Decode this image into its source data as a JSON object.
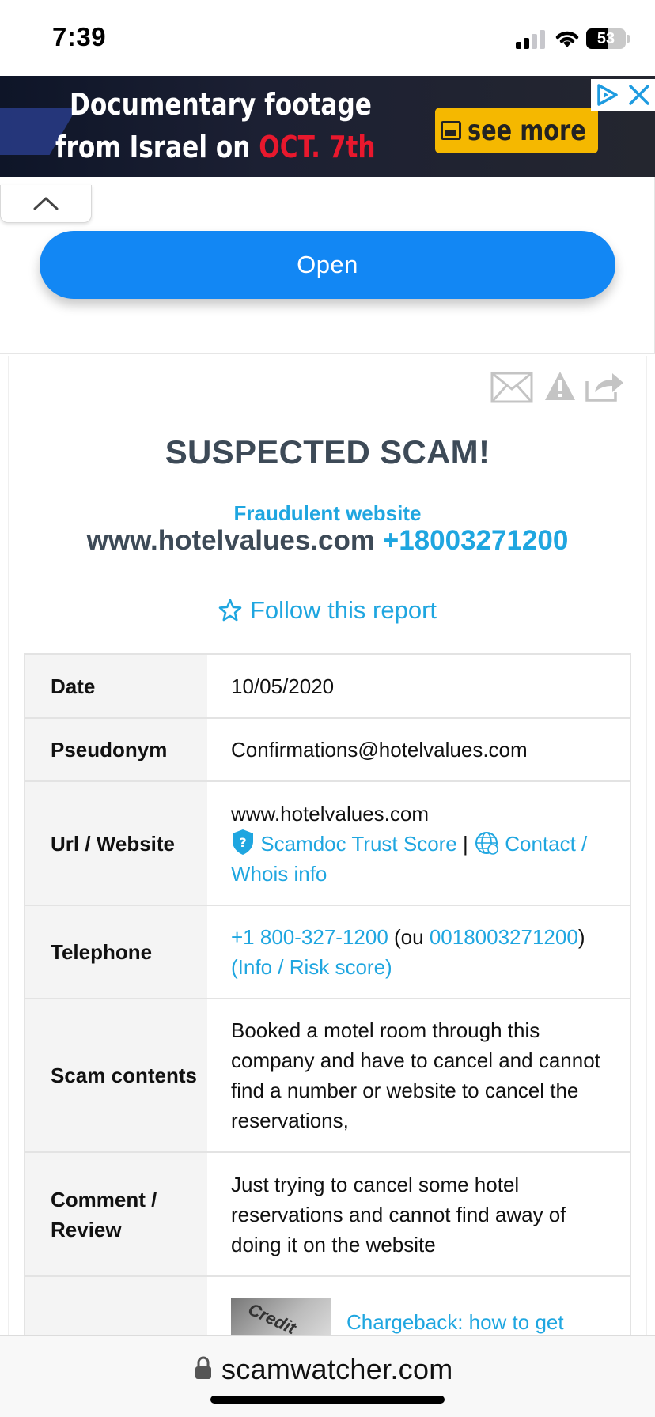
{
  "status_bar": {
    "time": "7:39",
    "battery": "53"
  },
  "ad": {
    "line1": "Documentary footage",
    "line2_prefix": "from Israel on ",
    "line2_highlight": "OCT. 7th",
    "cta": "see more"
  },
  "app_prompt": {
    "open_label": "Open"
  },
  "report": {
    "title": "SUSPECTED SCAM!",
    "category": "Fraudulent website",
    "site": "www.hotelvalues.com",
    "phone": "+18003271200",
    "follow_label": "Follow this report"
  },
  "table": {
    "date": {
      "label": "Date",
      "value": "10/05/2020"
    },
    "pseudonym": {
      "label": "Pseudonym",
      "value": "Confirmations@hotelvalues.com"
    },
    "url": {
      "label": "Url / Website",
      "value": "www.hotelvalues.com",
      "trust_link": "Scamdoc Trust Score",
      "separator": " | ",
      "whois_link": "Contact / Whois info"
    },
    "telephone": {
      "label": "Telephone",
      "phone_link": "+1 800-327-1200",
      "ou_text": " (ou ",
      "alt_phone_link": "0018003271200",
      "close_paren": ") ",
      "info_link": "(Info / Risk score)"
    },
    "scam": {
      "label": "Scam contents",
      "value": "Booked a motel room through this company and have to cancel and cannot find a number or website to cancel the reservations,"
    },
    "comment": {
      "label": "Comment / Review",
      "value": "Just trying to cancel some hotel reservations and cannot find away of doing it on the website"
    },
    "last": {
      "thumb_text": "Credit",
      "link": "Chargeback: how to get"
    }
  },
  "browser": {
    "domain": "scamwatcher.com"
  },
  "colors": {
    "accent": "#1fa6e0",
    "button": "#1287f4",
    "title": "#3d4a57"
  },
  "icons": [
    "wifi-icon",
    "battery-icon",
    "ad-info-icon",
    "ad-close-icon",
    "chevron-up-icon",
    "mail-icon",
    "warning-icon",
    "share-icon",
    "star-icon",
    "shield-icon",
    "globe-icon",
    "lock-icon"
  ]
}
